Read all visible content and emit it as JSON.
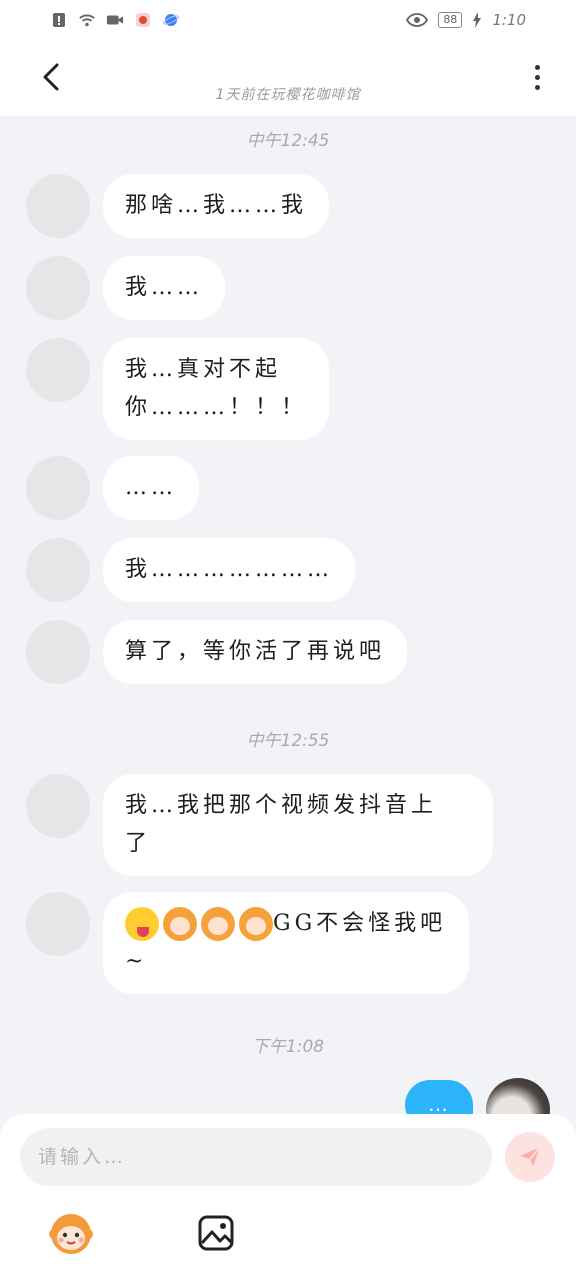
{
  "status_bar": {
    "time": "1:10",
    "battery": "88",
    "left_icons": [
      "alert-icon",
      "wifi-icon",
      "video-icon",
      "app-badge-icon",
      "planet-icon"
    ],
    "right_icons": [
      "eye-icon",
      "battery-icon",
      "charging-icon"
    ]
  },
  "header": {
    "subtitle": "1天前在玩樱花咖啡馆",
    "back_icon": "chevron-left-icon",
    "more_icon": "more-vertical-icon"
  },
  "messages": [
    {
      "type": "timestamp",
      "text": "中午12:45"
    },
    {
      "type": "incoming",
      "text": "那啥…我……我"
    },
    {
      "type": "incoming",
      "text": "我……"
    },
    {
      "type": "incoming",
      "line1": "我…真对不起",
      "line2": "你………！！！"
    },
    {
      "type": "incoming",
      "text": "……"
    },
    {
      "type": "incoming",
      "text": "我…………………"
    },
    {
      "type": "incoming",
      "text": "算了，等你活了再说吧"
    },
    {
      "type": "timestamp",
      "text": "中午12:55"
    },
    {
      "type": "incoming",
      "line1": "我…我把那个视频发抖音上",
      "line2": "了"
    },
    {
      "type": "incoming",
      "emojis": [
        "winking-tongue-emoji",
        "monkey-emoji",
        "monkey-emoji",
        "monkey-emoji"
      ],
      "line1": "GG不会怪我吧",
      "line2": "~"
    },
    {
      "type": "timestamp",
      "text": "下午1:08"
    },
    {
      "type": "outgoing",
      "text": "…"
    }
  ],
  "composer": {
    "placeholder": "请输入…",
    "value": "",
    "send_icon": "send-icon",
    "tools": [
      "monkey-sticker-icon",
      "image-icon"
    ]
  },
  "colors": {
    "background": "#f2f3f6",
    "bubble_incoming": "#ffffff",
    "bubble_outgoing": "#2bb4f7",
    "send_button": "#fde3e0",
    "avatar_placeholder": "#e6e6e8"
  }
}
